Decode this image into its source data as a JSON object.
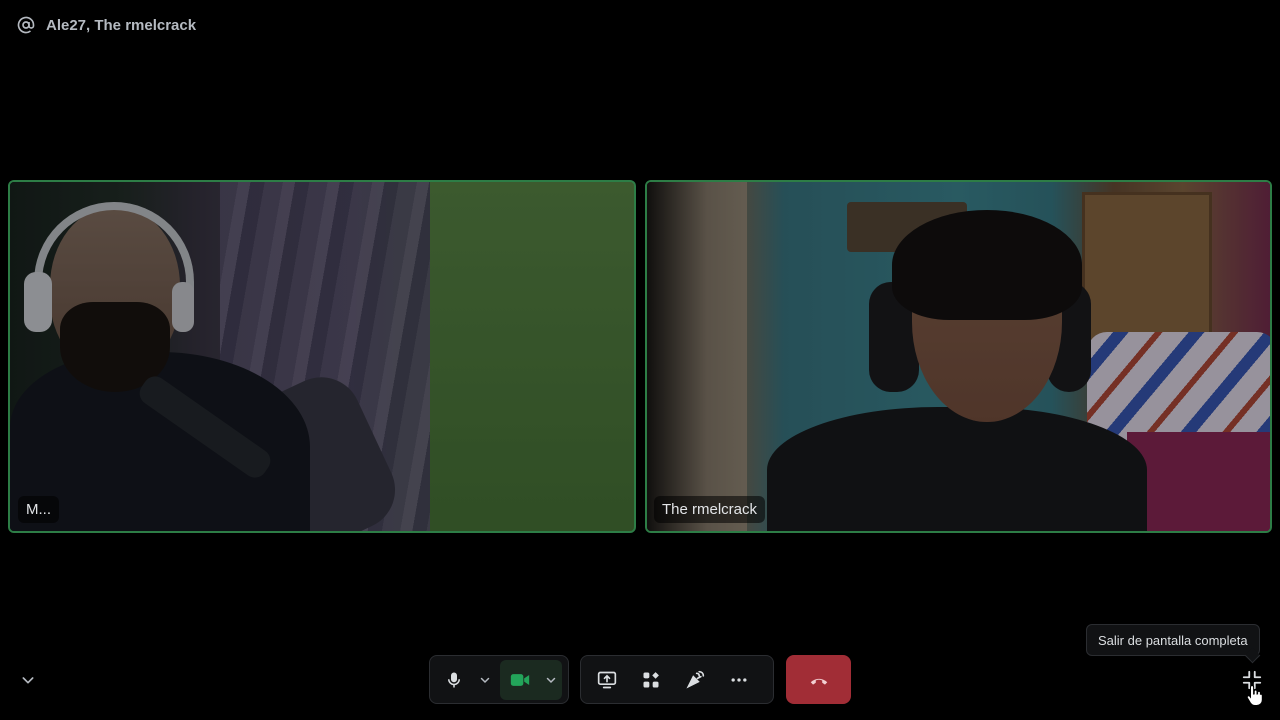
{
  "header": {
    "icon": "at-icon",
    "title": "Ale27, The rmelcrack"
  },
  "participants": [
    {
      "name": "M...",
      "video": "on",
      "speaking_outline": true
    },
    {
      "name": "The rmelcrack",
      "video": "on",
      "speaking_outline": true
    }
  ],
  "controls": {
    "microphone": {
      "icon": "microphone-icon",
      "options_icon": "chevron-down-icon"
    },
    "camera": {
      "icon": "video-camera-icon",
      "options_icon": "chevron-down-icon",
      "state": "on"
    },
    "share_screen": {
      "icon": "screen-share-icon"
    },
    "activities": {
      "icon": "activities-icon"
    },
    "soundboard": {
      "icon": "soundboard-icon"
    },
    "more": {
      "icon": "more-dots-icon"
    },
    "disconnect": {
      "icon": "hang-up-icon"
    },
    "collapse": {
      "icon": "chevron-down-icon"
    },
    "exit_fullscreen": {
      "icon": "exit-fullscreen-icon"
    }
  },
  "tooltip": {
    "text": "Salir de pantalla completa"
  },
  "colors": {
    "background": "#000000",
    "speaking_border": "#2d7d46",
    "disconnect": "#a12d36",
    "camera_on": "#23a55a"
  }
}
